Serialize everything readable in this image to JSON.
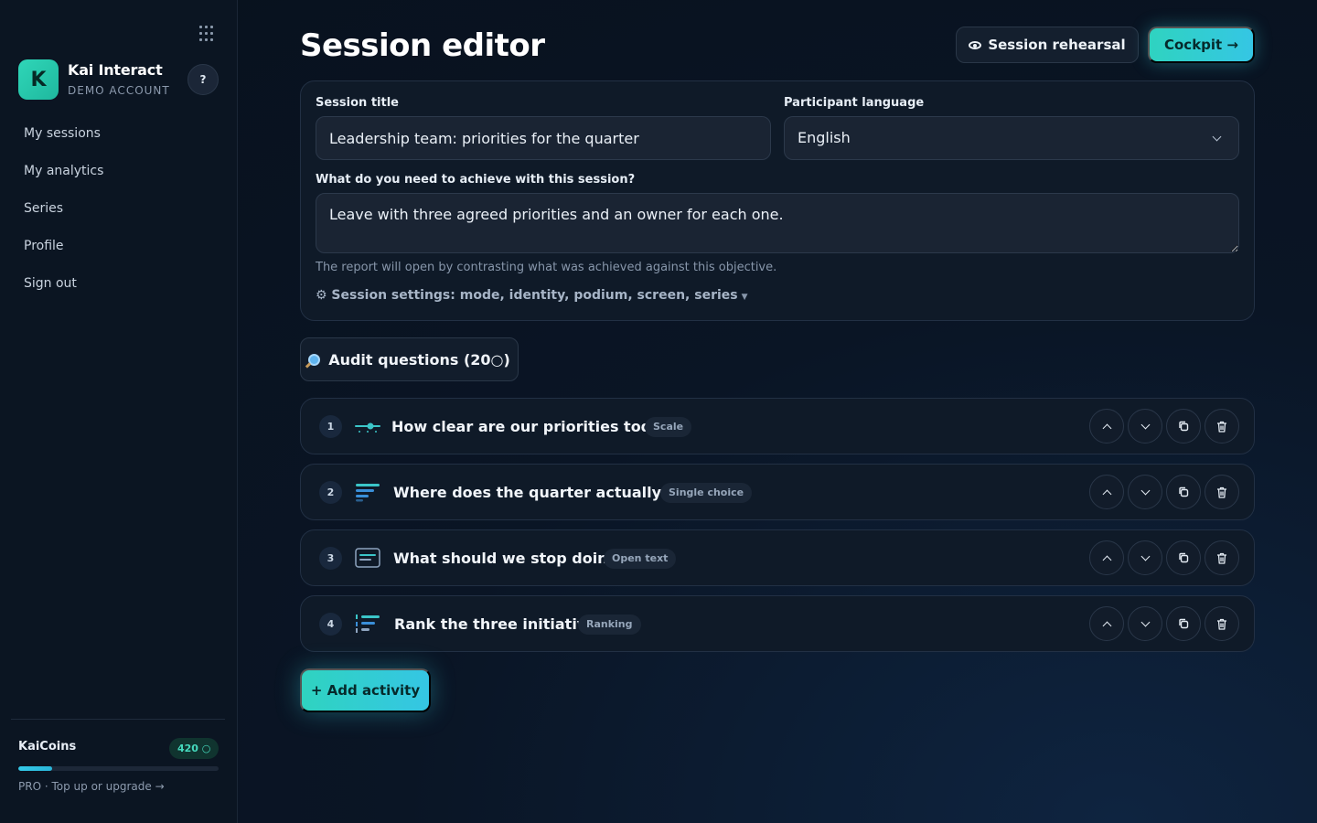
{
  "sidebar": {
    "brand_initial": "K",
    "brand_name": "Kai Interact",
    "brand_subtitle": "DEMO ACCOUNT",
    "help_label": "?",
    "nav": [
      "My sessions",
      "My analytics",
      "Series",
      "Profile",
      "Sign out"
    ],
    "coins": {
      "label": "KaiCoins",
      "badge": "420 ○",
      "progress_fraction": 0.17,
      "link": "PRO · Top up or upgrade →"
    }
  },
  "header": {
    "title": "Session editor",
    "rehearsal_label": "Session rehearsal",
    "cockpit_label": "Cockpit →"
  },
  "settings": {
    "title_label": "Session title",
    "title_value": "Leadership team: priorities for the quarter",
    "language_label": "Participant language",
    "language_value": "English",
    "objective_label": "What do you need to achieve with this session?",
    "objective_value": "Leave with three agreed priorities and an owner for each one.",
    "objective_help": "The report will open by contrasting what was achieved against this objective.",
    "settings_toggle": "⚙ Session settings: mode, identity, podium, screen, series",
    "settings_caret": "▼"
  },
  "audit": {
    "label": "Audit questions (20○)"
  },
  "activities": [
    {
      "number": "1",
      "title": "How clear are our priorities today?",
      "type": "Scale",
      "icon": "scale-slider-icon"
    },
    {
      "number": "2",
      "title": "Where does the quarter actually go?",
      "type": "Single choice",
      "icon": "single-choice-bars-icon"
    },
    {
      "number": "3",
      "title": "What should we stop doing?",
      "type": "Open text",
      "icon": "open-text-box-icon"
    },
    {
      "number": "4",
      "title": "Rank the three initiatives",
      "type": "Ranking",
      "icon": "ranking-list-icon"
    }
  ],
  "add_activity_label": "+ Add activity",
  "colors": {
    "accent_teal": "#2fd3c0",
    "accent_cyan": "#35c6e4",
    "background": "#08111d",
    "card": "#0f1a28"
  }
}
